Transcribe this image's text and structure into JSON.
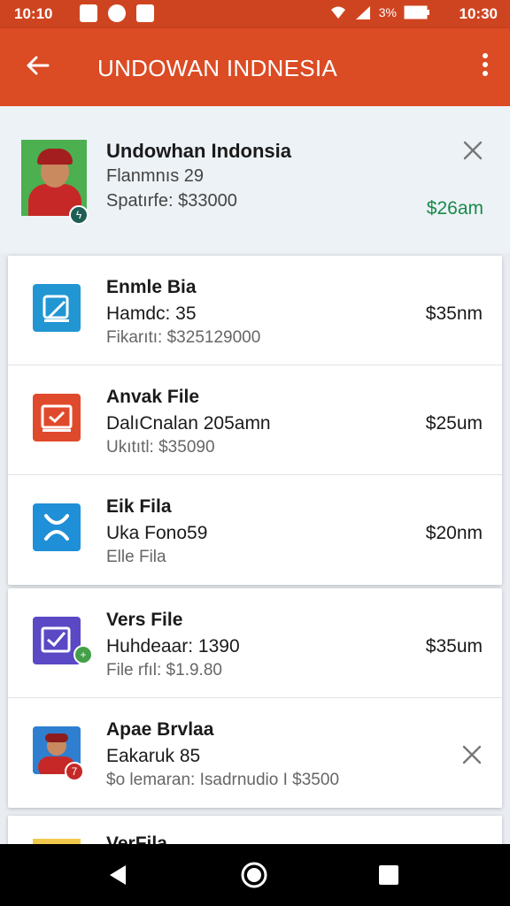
{
  "status_bar": {
    "time": "10:10",
    "battery_text": "3%",
    "clock": "10:30"
  },
  "app_bar": {
    "title": "UNDOWAN INDNESIA",
    "back_icon": "arrow-back-icon",
    "menu_icon": "more-vert-icon"
  },
  "header": {
    "name": "Undowhan Indonsia",
    "line1": "Flanmnıs 29",
    "line2": "Spatırfe: $33000",
    "amount": "$26am",
    "amount_color": "#178a4a"
  },
  "items": [
    {
      "title": "Enmle Bia",
      "subtitle": "Hamdc: 35",
      "detail": "Fikarıtı: $325129000",
      "amount": "$35nm",
      "icon": "file-edit-icon",
      "icon_color": "#2196d3"
    },
    {
      "title": "Anvak File",
      "subtitle": "DalıCnalan 205amn",
      "detail": "Ukıtıtl: $35090",
      "amount": "$25um",
      "icon": "file-check-icon",
      "icon_color": "#e04a2c"
    },
    {
      "title": "Eik Fila",
      "subtitle": "Uka Fono59",
      "detail": "Elle Fila",
      "amount": "$20nm",
      "icon": "file-cross-icon",
      "icon_color": "#1f8fd8"
    },
    {
      "title": "Vers File",
      "subtitle": "Huhdeaar: 1390",
      "detail": "File rfıl: $1.9.80",
      "amount": "$35um",
      "icon": "calendar-check-icon",
      "icon_color": "#5a48c4"
    },
    {
      "title": "Apae Brvlaa",
      "subtitle": "Eakaruk 85",
      "detail": "$o lemaran: Isadrnudio I $3500",
      "amount": "",
      "icon": "avatar",
      "icon_color": "#2f7fd0"
    }
  ],
  "peek_item": {
    "title": "VerFila"
  }
}
